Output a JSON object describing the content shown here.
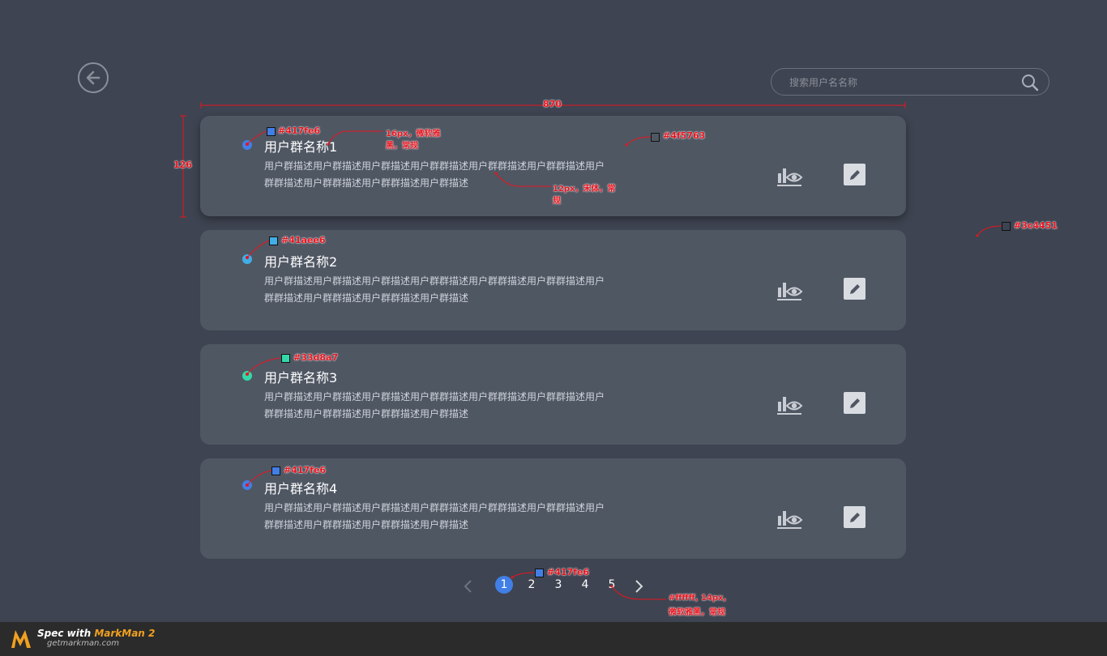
{
  "back_button": {
    "icon": "back-arrow-icon"
  },
  "search": {
    "placeholder": "搜索用户名名称",
    "icon": "search-icon"
  },
  "cards": [
    {
      "name": "用户群名称1",
      "dot_color": "#417fe6",
      "desc": "用户群描述用户群描述用户群描述用户群群描述用户群群描述用户群群描述用户群群描述用户群群描述用户群群描述用户群描述"
    },
    {
      "name": "用户群名称2",
      "dot_color": "#41aee6",
      "desc": "用户群描述用户群描述用户群描述用户群群描述用户群群描述用户群群描述用户群群描述用户群群描述用户群群描述用户群描述"
    },
    {
      "name": "用户群名称3",
      "dot_color": "#33d8a7",
      "desc": "用户群描述用户群描述用户群描述用户群群描述用户群群描述用户群群描述用户群群描述用户群群描述用户群群描述用户群描述"
    },
    {
      "name": "用户群名称4",
      "dot_color": "#417fe6",
      "desc": "用户群描述用户群描述用户群描述用户群群描述用户群群描述用户群群描述用户群群描述用户群群描述用户群群描述用户群描述"
    }
  ],
  "pagination": {
    "pages": [
      "1",
      "2",
      "3",
      "4",
      "5"
    ],
    "active": "1",
    "active_color": "#417fe6"
  },
  "annotations": {
    "width": "870",
    "height": "126",
    "color1": "#417fe6",
    "color2": "#41aee6",
    "color3": "#33d8a7",
    "color4": "#417fe6",
    "card_bg": "#4f5763",
    "page_bg": "#3c4451",
    "pager_color": "#417fe6",
    "title_font_1": "16px，微软雅",
    "title_font_2": "黑，常规",
    "desc_font_1": "12px，宋体，常",
    "desc_font_2": "规",
    "pager_font_1": "#ffffff, 14px,",
    "pager_font_2": "微软雅黑，常规"
  },
  "footer": {
    "brand_prefix": "Spec with ",
    "brand": "MarkMan 2",
    "url": "getmarkman.com"
  }
}
